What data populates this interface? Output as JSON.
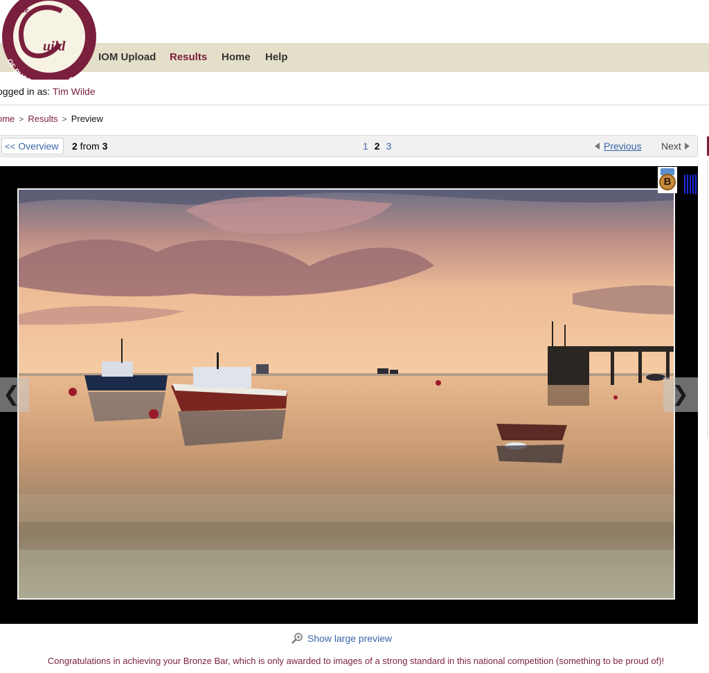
{
  "logo": {
    "top_text": "The",
    "script_text": "uild",
    "ring_text": "OF PHOTOGRAPHERS"
  },
  "nav": {
    "items": [
      {
        "label": "IOM Upload",
        "active": false
      },
      {
        "label": "Results",
        "active": true
      },
      {
        "label": "Home",
        "active": false
      },
      {
        "label": "Help",
        "active": false
      }
    ]
  },
  "login": {
    "prefix": "ogged in as: ",
    "user": "Tim Wilde"
  },
  "breadcrumb": {
    "home": "ome",
    "results": "Results",
    "current": "Preview"
  },
  "pager": {
    "overview_label": "Overview",
    "current": "2",
    "from_word": " from ",
    "total": "3",
    "pages": [
      "1",
      "2",
      "3"
    ],
    "current_page": "2",
    "previous_label": "Previous",
    "next_label": "Next"
  },
  "award": {
    "letter": "B",
    "level": "Bronze"
  },
  "viewer": {
    "prev_arrow": "❮",
    "next_arrow": "❯"
  },
  "preview_link": "Show large preview",
  "message": "Congratulations in achieving your Bronze Bar, which is only awarded to images of a strong standard in this national competition (something to be proud of)!",
  "colors": {
    "brand": "#7a1f3d",
    "navbar": "#e4dfc8",
    "link": "#3a66a8"
  }
}
